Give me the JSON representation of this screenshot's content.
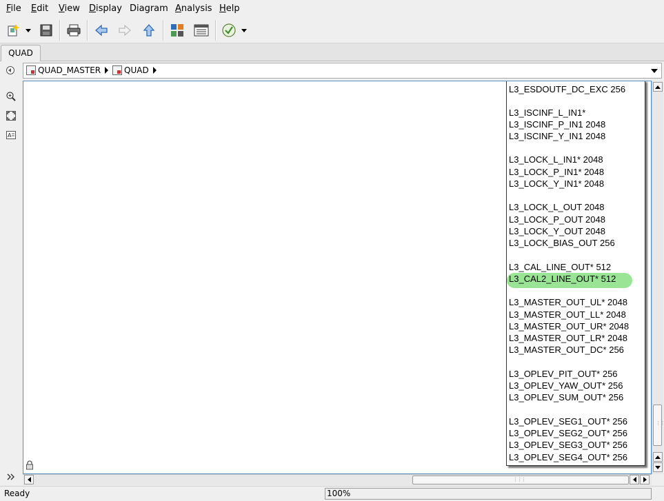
{
  "menubar": {
    "items": [
      {
        "label": "File",
        "mnemonic": "F",
        "rest": "ile"
      },
      {
        "label": "Edit",
        "mnemonic": "E",
        "rest": "dit"
      },
      {
        "label": "View",
        "mnemonic": "V",
        "rest": "iew"
      },
      {
        "label": "Display",
        "mnemonic": "D",
        "rest": "isplay"
      },
      {
        "label": "Diagram",
        "mnemonic": "",
        "rest": "Diagram"
      },
      {
        "label": "Analysis",
        "mnemonic": "A",
        "rest": "nalysis"
      },
      {
        "label": "Help",
        "mnemonic": "H",
        "rest": "elp"
      }
    ]
  },
  "toolbar": {
    "icons": [
      "new-block-icon",
      "dropdown-icon",
      "save-icon",
      "print-icon",
      "back-arrow-icon",
      "forward-arrow-icon",
      "up-arrow-icon",
      "library-icon",
      "properties-icon",
      "check-icon",
      "dropdown-icon"
    ]
  },
  "tabs": [
    {
      "label": "QUAD"
    }
  ],
  "breadcrumb": {
    "items": [
      {
        "label": "QUAD_MASTER"
      },
      {
        "label": "QUAD"
      }
    ]
  },
  "signals": [
    {
      "text": "L3_ESDOUTF_DC_EXC 256"
    },
    {
      "text": "L3_ISCINF_L_IN1*"
    },
    {
      "text": "L3_ISCINF_P_IN1 2048"
    },
    {
      "text": "L3_ISCINF_Y_IN1 2048"
    },
    {
      "text": "L3_LOCK_L_IN1* 2048"
    },
    {
      "text": "L3_LOCK_P_IN1* 2048"
    },
    {
      "text": "L3_LOCK_Y_IN1* 2048"
    },
    {
      "text": "L3_LOCK_L_OUT 2048"
    },
    {
      "text": "L3_LOCK_P_OUT 2048"
    },
    {
      "text": "L3_LOCK_Y_OUT 2048"
    },
    {
      "text": "L3_LOCK_BIAS_OUT 256"
    },
    {
      "text": "L3_CAL_LINE_OUT* 512"
    },
    {
      "text": "L3_CAL2_LINE_OUT* 512",
      "highlighted": true
    },
    {
      "text": "L3_MASTER_OUT_UL* 2048"
    },
    {
      "text": "L3_MASTER_OUT_LL* 2048"
    },
    {
      "text": "L3_MASTER_OUT_UR* 2048"
    },
    {
      "text": "L3_MASTER_OUT_LR* 2048"
    },
    {
      "text": "L3_MASTER_OUT_DC* 256"
    },
    {
      "text": "L3_OPLEV_PIT_OUT* 256"
    },
    {
      "text": "L3_OPLEV_YAW_OUT* 256"
    },
    {
      "text": "L3_OPLEV_SUM_OUT* 256"
    },
    {
      "text": "L3_OPLEV_SEG1_OUT* 256"
    },
    {
      "text": "L3_OPLEV_SEG2_OUT* 256"
    },
    {
      "text": "L3_OPLEV_SEG3_OUT* 256"
    },
    {
      "text": "L3_OPLEV_SEG4_OUT* 256"
    }
  ],
  "highlight_color": "#8fe28a",
  "status": {
    "text": "Ready",
    "zoom": "100%"
  }
}
